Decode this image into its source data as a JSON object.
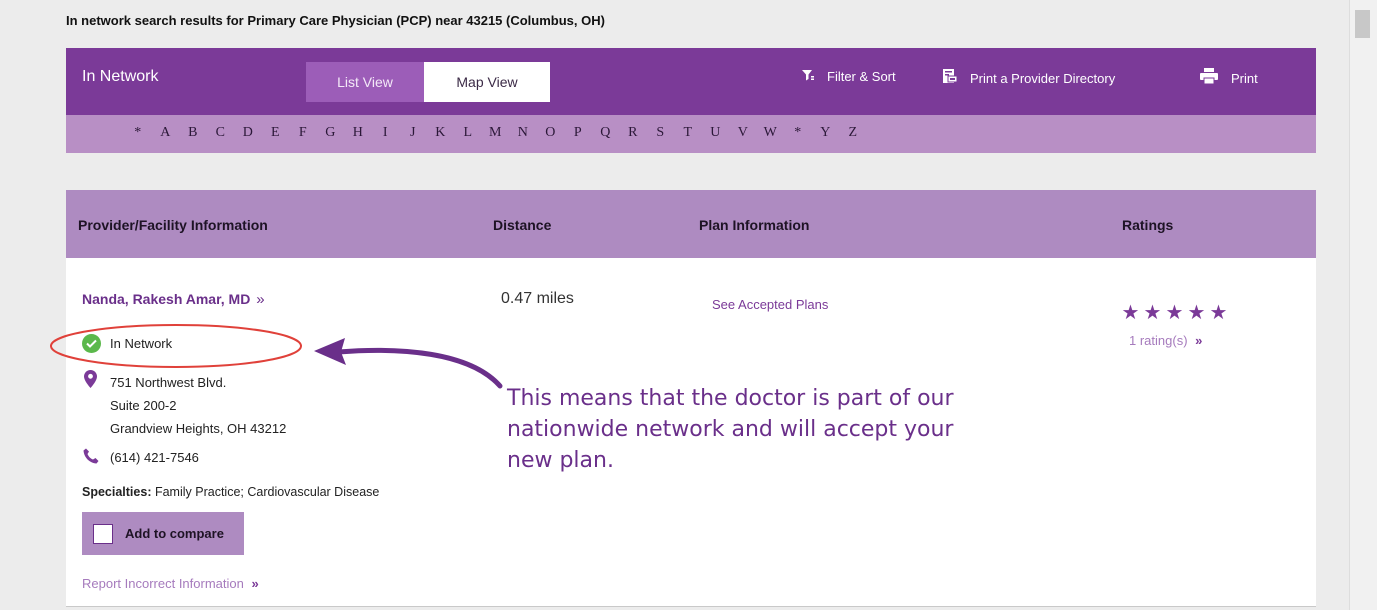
{
  "results_title": "In network search results for Primary Care Physician (PCP) near 43215 (Columbus, OH)",
  "topbar": {
    "title": "In Network",
    "tabs": {
      "list": "List View",
      "map": "Map View"
    },
    "filter_label": "Filter & Sort",
    "directory_label": "Print a Provider Directory",
    "print_label": "Print"
  },
  "alphabet": [
    "*",
    "A",
    "B",
    "C",
    "D",
    "E",
    "F",
    "G",
    "H",
    "I",
    "J",
    "K",
    "L",
    "M",
    "N",
    "O",
    "P",
    "Q",
    "R",
    "S",
    "T",
    "U",
    "V",
    "W",
    "*",
    "Y",
    "Z"
  ],
  "table_header": {
    "provider": "Provider/Facility Information",
    "distance": "Distance",
    "plan": "Plan Information",
    "ratings": "Ratings"
  },
  "provider": {
    "name": "Nanda, Rakesh Amar, MD",
    "name_arrow": "»",
    "network_status": "In Network",
    "address_line1": "751 Northwest Blvd.",
    "address_line2": "Suite 200-2",
    "address_line3": "Grandview Heights, OH 43212",
    "phone": "(614) 421-7546",
    "specialties_label": "Specialties:",
    "specialties": "Family Practice; Cardiovascular Disease",
    "distance": "0.47 miles",
    "plans_link": "See Accepted Plans",
    "rating_stars": 5,
    "rating_count": "1 rating(s)",
    "rating_arrow": "»",
    "compare_label": "Add to compare",
    "report_link": "Report Incorrect Information",
    "report_arrow": "»"
  },
  "annotation": {
    "text": "This means that the doctor is part of our nationwide network and will accept your new plan."
  },
  "colors": {
    "brand_purple": "#7b3a98",
    "alphabar": "#b88fc5",
    "header_lavender": "#ae8bc1",
    "check_green": "#5bb84b",
    "annotation_red": "#e0413a"
  }
}
